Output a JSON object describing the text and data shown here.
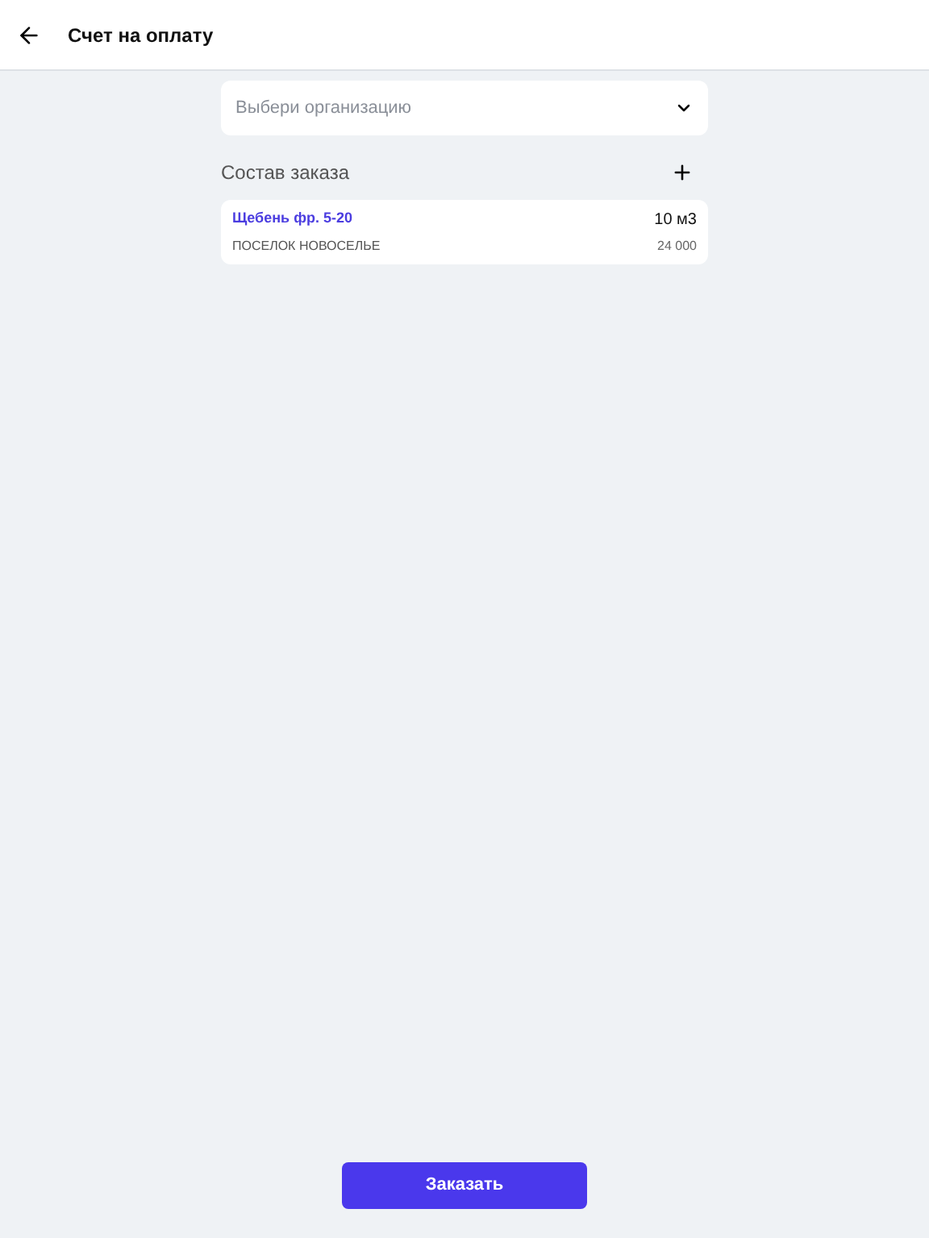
{
  "header": {
    "title": "Счет на оплату"
  },
  "organization_select": {
    "placeholder": "Выбери организацию"
  },
  "order_section": {
    "title": "Состав заказа"
  },
  "order_items": [
    {
      "name": "Щебень фр. 5-20",
      "location": "ПОСЕЛОК НОВОСЕЛЬЕ",
      "quantity": "10 м3",
      "price": "24 000"
    }
  ],
  "submit_button": {
    "label": "Заказать"
  }
}
